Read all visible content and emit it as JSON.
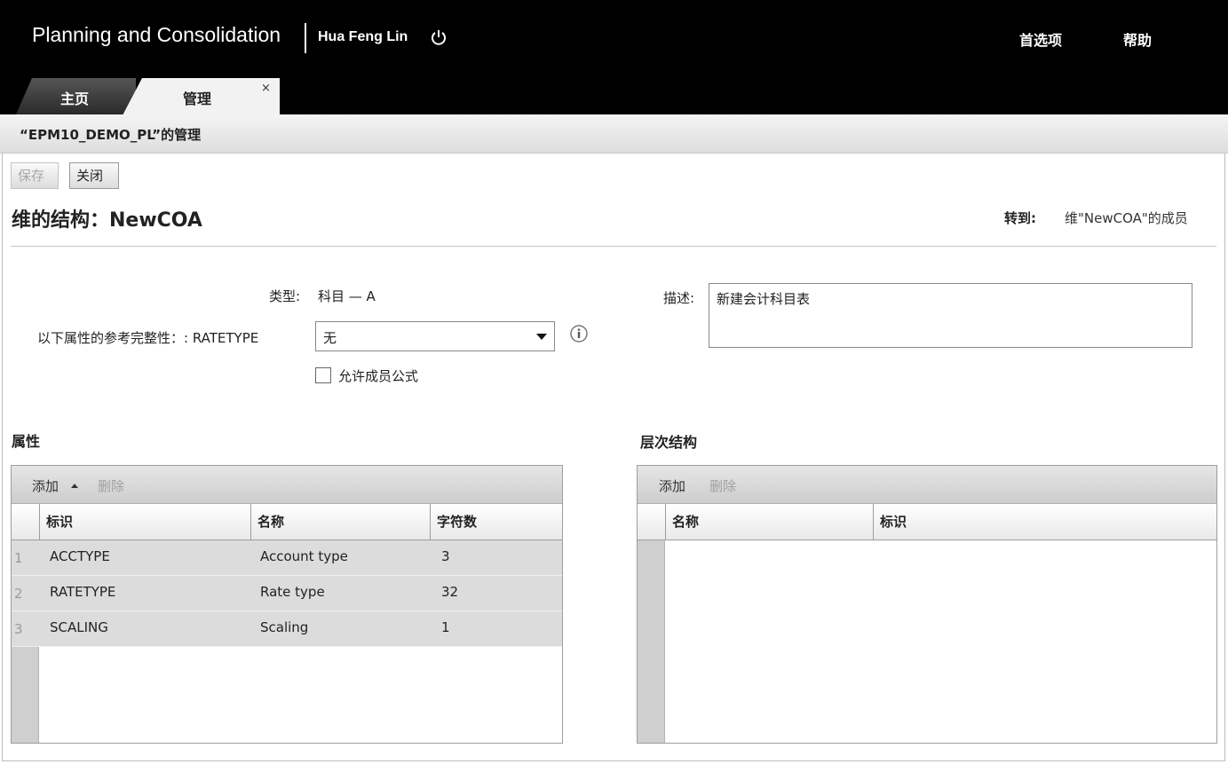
{
  "header": {
    "app_title": "Planning and Consolidation",
    "user_name": "Hua Feng Lin",
    "preferences": "首选项",
    "help": "帮助"
  },
  "tabs": [
    {
      "label": "主页"
    },
    {
      "label": "管理",
      "close": "×"
    }
  ],
  "subbar_title": "“EPM10_DEMO_PL”的管理",
  "toolbar": {
    "save": "保存",
    "close": "关闭"
  },
  "page": {
    "heading": "维的结构：NewCOA",
    "goto_label": "转到:",
    "goto_link": "维\"NewCOA\"的成员"
  },
  "form": {
    "type_label": "类型:",
    "type_value": "科目 — A",
    "ref_label": "以下属性的参考完整性：: RATETYPE",
    "ref_value": "无",
    "checkbox_label": "允许成员公式",
    "desc_label": "描述:",
    "desc_value": "新建会计科目表"
  },
  "attributes": {
    "title": "属性",
    "add": "添加",
    "delete": "删除",
    "columns": [
      "标识",
      "名称",
      "字符数"
    ],
    "rows": [
      {
        "num": "1",
        "id": "ACCTYPE",
        "name": "Account type",
        "chars": "3"
      },
      {
        "num": "2",
        "id": "RATETYPE",
        "name": "Rate type",
        "chars": "32"
      },
      {
        "num": "3",
        "id": "SCALING",
        "name": "Scaling",
        "chars": "1"
      }
    ]
  },
  "hierarchy": {
    "title": "层次结构",
    "add": "添加",
    "delete": "删除",
    "columns": [
      "名称",
      "标识"
    ]
  }
}
